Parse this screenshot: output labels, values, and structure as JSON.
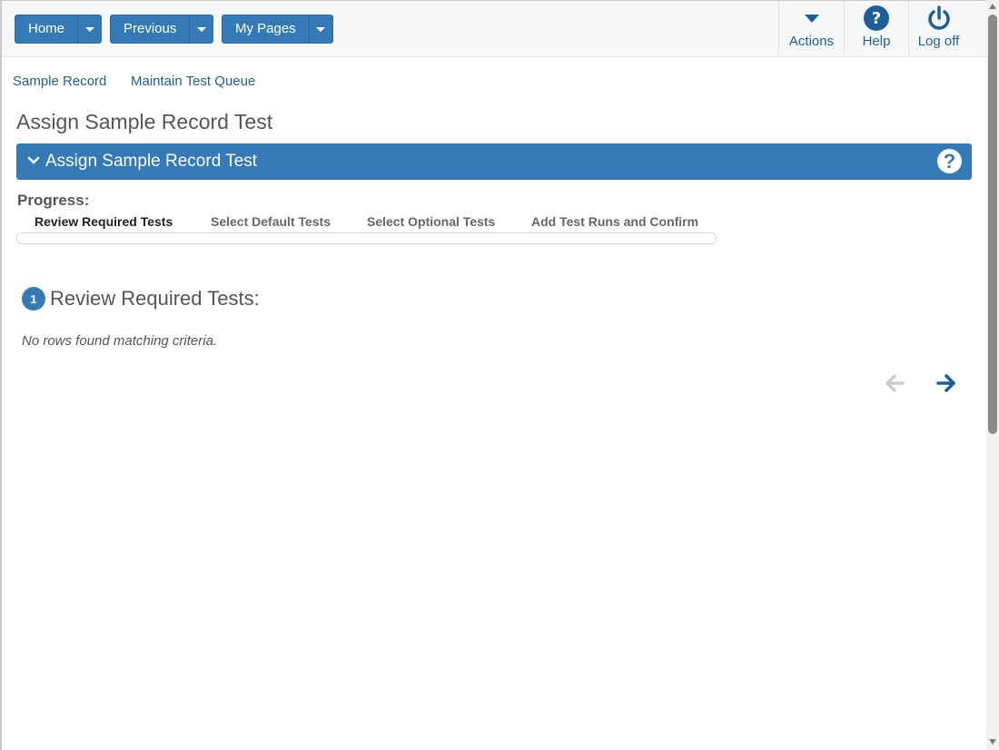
{
  "toolbar": {
    "home_label": "Home",
    "previous_label": "Previous",
    "my_pages_label": "My Pages",
    "actions_label": "Actions",
    "help_label": "Help",
    "logoff_label": "Log off"
  },
  "breadcrumb": {
    "items": [
      "Sample Record",
      "Maintain Test Queue"
    ]
  },
  "page": {
    "title": "Assign Sample Record Test"
  },
  "panel": {
    "title": "Assign Sample Record Test",
    "help_glyph": "?"
  },
  "progress": {
    "label": "Progress:",
    "steps": [
      "Review Required Tests",
      "Select Default Tests",
      "Select Optional Tests",
      "Add Test Runs and Confirm"
    ],
    "active_step": 0
  },
  "section": {
    "number": "1",
    "title": "Review Required Tests:",
    "empty_message": "No rows found matching criteria."
  },
  "icons": {
    "actions": "caret-down-icon",
    "help": "question-circle-icon",
    "logoff": "power-icon",
    "prev": "arrow-left-icon",
    "next": "arrow-right-icon"
  },
  "colors": {
    "primary": "#337ab7",
    "link": "#1f5f93",
    "disabled_arrow": "#cccccc",
    "active_arrow": "#1a5f98"
  }
}
